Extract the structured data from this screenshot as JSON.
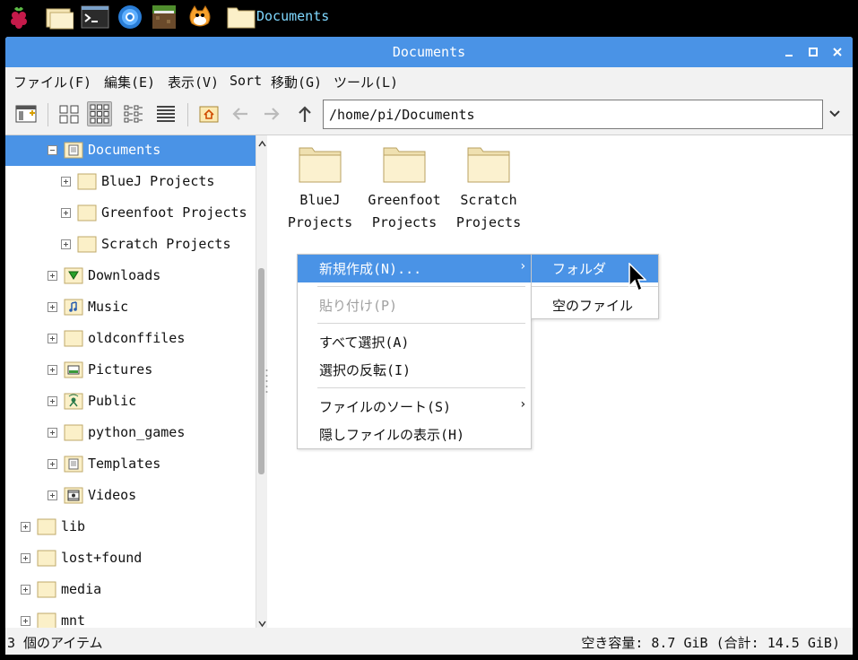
{
  "taskbar": {
    "icons": [
      "raspberry-icon",
      "file-manager-icon",
      "terminal-icon",
      "browser-icon",
      "minecraft-icon",
      "scratch-icon"
    ],
    "task_label": "Documents"
  },
  "window": {
    "title": "Documents",
    "buttons": {
      "minimize": "–",
      "maximize": "□",
      "close": "✕"
    }
  },
  "menubar": {
    "items": [
      "ファイル(F)",
      "編集(E)",
      "表示(V)",
      "Sort",
      "移動(G)",
      "ツール(L)"
    ]
  },
  "toolbar": {
    "path": "/home/pi/Documents"
  },
  "sidebar": {
    "items": [
      {
        "label": "Documents",
        "icon": "documents-folder-icon",
        "expander": "minus",
        "selected": true
      },
      {
        "label": "BlueJ Projects",
        "icon": "folder-icon",
        "expander": "plus"
      },
      {
        "label": "Greenfoot Projects",
        "icon": "folder-icon",
        "expander": "plus"
      },
      {
        "label": "Scratch Projects",
        "icon": "folder-icon",
        "expander": "plus"
      },
      {
        "label": "Downloads",
        "icon": "downloads-folder-icon",
        "expander": "plus"
      },
      {
        "label": "Music",
        "icon": "music-folder-icon",
        "expander": "plus"
      },
      {
        "label": "oldconffiles",
        "icon": "folder-icon",
        "expander": "plus"
      },
      {
        "label": "Pictures",
        "icon": "pictures-folder-icon",
        "expander": "plus"
      },
      {
        "label": "Public",
        "icon": "public-folder-icon",
        "expander": "plus"
      },
      {
        "label": "python_games",
        "icon": "folder-icon",
        "expander": "plus"
      },
      {
        "label": "Templates",
        "icon": "templates-folder-icon",
        "expander": "plus"
      },
      {
        "label": "Videos",
        "icon": "videos-folder-icon",
        "expander": "plus"
      },
      {
        "label": "lib",
        "icon": "folder-icon",
        "expander": "plus"
      },
      {
        "label": "lost+found",
        "icon": "folder-icon",
        "expander": "plus"
      },
      {
        "label": "media",
        "icon": "folder-icon",
        "expander": "plus"
      },
      {
        "label": "mnt",
        "icon": "folder-icon",
        "expander": "plus"
      }
    ]
  },
  "files": [
    {
      "line1": "BlueJ",
      "line2": "Projects"
    },
    {
      "line1": "Greenfoot",
      "line2": "Projects"
    },
    {
      "line1": "Scratch",
      "line2": "Projects"
    }
  ],
  "context_menu": {
    "new": "新規作成(N)...",
    "paste": "貼り付け(P)",
    "select_all": "すべて選択(A)",
    "invert_selection": "選択の反転(I)",
    "sort_files": "ファイルのソート(S)",
    "show_hidden": "隠しファイルの表示(H)",
    "submenu_arrow": "›"
  },
  "submenu": {
    "folder": "フォルダ",
    "empty_file": "空のファイル"
  },
  "status": {
    "item_count": "3 個のアイテム",
    "free_space": "空き容量: 8.7 GiB (合計: 14.5 GiB)"
  }
}
